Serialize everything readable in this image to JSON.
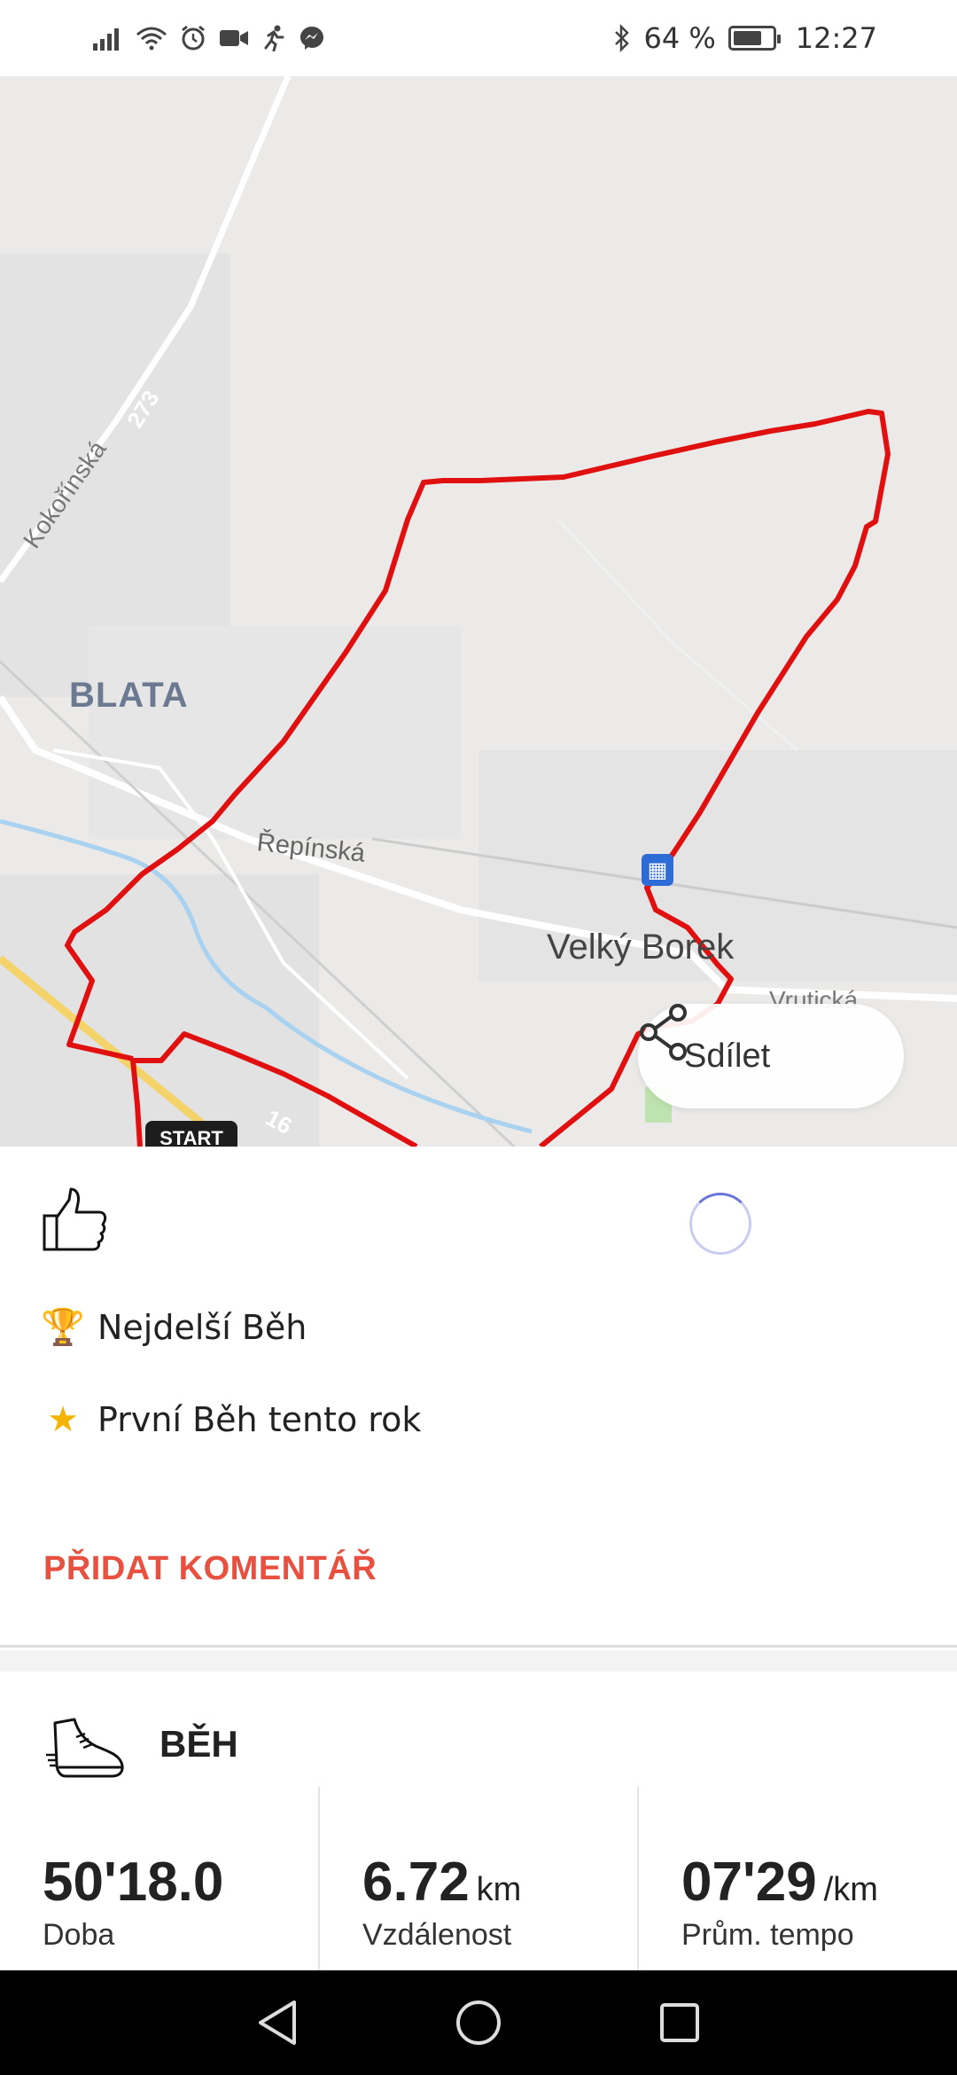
{
  "status_bar": {
    "icons_left": [
      "signal-icon",
      "wifi-icon",
      "alarm-icon",
      "video-icon",
      "running-icon",
      "messenger-icon"
    ],
    "bluetooth": "bluetooth-icon",
    "battery_text": "64 %",
    "battery_level": 0.64,
    "time": "12:27"
  },
  "map": {
    "labels": {
      "blata": "BLATA",
      "velky_borek": "Velký Borek",
      "repinska": "Řepínská",
      "kokorinska": "Kokořínská",
      "vruticka": "Vrutická",
      "road_273": "273",
      "road_16": "16"
    },
    "start_badge": "START",
    "route_color": "#e01010",
    "share": {
      "label": "Sdílet",
      "icon": "share-icon"
    }
  },
  "social": {
    "like_icon": "thumbs-up-icon",
    "achievements": [
      {
        "icon": "trophy-icon",
        "text": "Nejdelší Běh"
      },
      {
        "icon": "star-icon",
        "text": "První Běh tento rok"
      }
    ],
    "add_comment": "PŘIDAT KOMENTÁŘ",
    "accent": "#e8513f"
  },
  "summary": {
    "sport": "BĚH",
    "stats": [
      {
        "value": "50'18.0",
        "unit": "",
        "label": "Doba"
      },
      {
        "value": "6.72",
        "unit": "km",
        "label": "Vzdálenost"
      },
      {
        "value": "07'29",
        "unit": "/km",
        "label": "Prům. tempo"
      }
    ]
  },
  "nav": {
    "back": "back-icon",
    "home": "home-icon",
    "recents": "recents-icon"
  }
}
